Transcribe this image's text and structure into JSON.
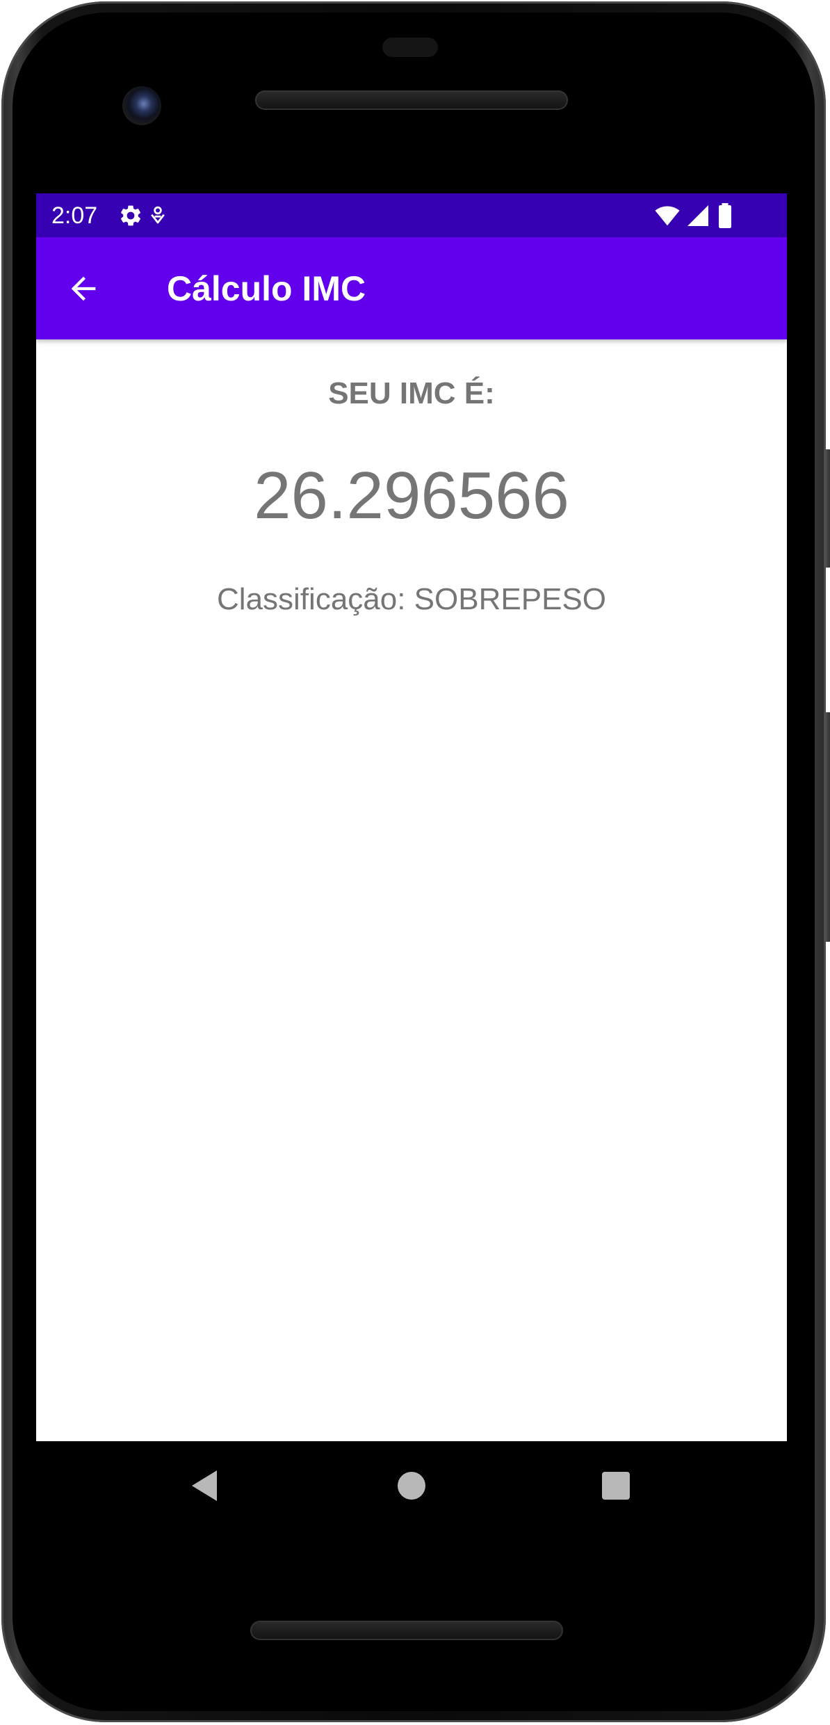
{
  "status_bar": {
    "time": "2:07",
    "icons": [
      "settings-icon",
      "notification-icon",
      "wifi-icon",
      "signal-icon",
      "battery-icon"
    ],
    "background": "#3700b3"
  },
  "app_bar": {
    "title": "Cálculo IMC",
    "back_icon": "arrow-back-icon",
    "background": "#6200ee"
  },
  "content": {
    "label": "SEU IMC É:",
    "imc_value": "26.296566",
    "classification": "Classificação: SOBREPESO",
    "text_color": "#757575"
  },
  "nav_bar": {
    "buttons": [
      "back-triangle-icon",
      "home-circle-icon",
      "recents-square-icon"
    ]
  }
}
